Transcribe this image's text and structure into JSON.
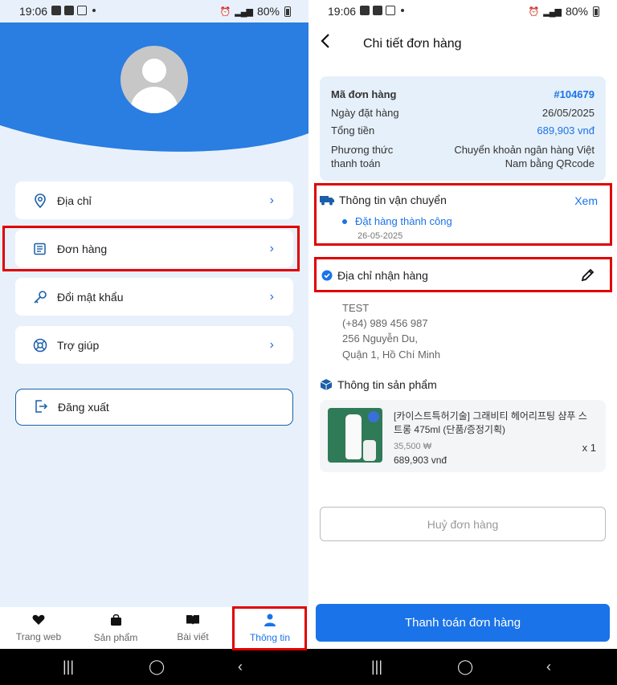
{
  "left": {
    "status": {
      "time": "19:06",
      "battery": "80%",
      "network": "Vo) LTE1"
    },
    "menu": [
      {
        "label": "Địa chỉ",
        "icon": "location-pin-icon"
      },
      {
        "label": "Đơn hàng",
        "icon": "receipt-icon"
      },
      {
        "label": "Đổi mật khẩu",
        "icon": "key-icon"
      },
      {
        "label": "Trợ giúp",
        "icon": "lifebuoy-icon"
      }
    ],
    "logout_label": "Đăng xuất",
    "nav": [
      {
        "label": "Trang web",
        "icon": "heart-icon"
      },
      {
        "label": "Sản phẩm",
        "icon": "shopping-bag-icon"
      },
      {
        "label": "Bài viết",
        "icon": "book-icon"
      },
      {
        "label": "Thông tin",
        "icon": "person-icon"
      }
    ]
  },
  "right": {
    "status": {
      "time": "19:06",
      "battery": "80%",
      "network": "Vo) LTE1"
    },
    "title": "Chi tiết đơn hàng",
    "summary": {
      "order_label": "Mã đơn hàng",
      "order_value": "#104679",
      "date_label": "Ngày đặt hàng",
      "date_value": "26/05/2025",
      "total_label": "Tổng tiền",
      "total_value": "689,903 vnđ",
      "payment_label_1": "Phương thức",
      "payment_label_2": "thanh toán",
      "payment_value_1": "Chuyển khoản ngân hàng Việt",
      "payment_value_2": "Nam bằng QRcode"
    },
    "shipping": {
      "title": "Thông tin vận chuyển",
      "view_link": "Xem",
      "status": "Đặt hàng thành công",
      "date": "26-05-2025"
    },
    "address": {
      "title": "Địa chỉ nhận hàng",
      "name": "TEST",
      "phone": "(+84) 989 456 987",
      "street": "256 Nguyễn Du,",
      "city": "Quận 1, Hồ Chí Minh"
    },
    "product_section_title": "Thông tin sản phẩm",
    "product": {
      "name": "[카이스트특허기술] 그래비티 헤어리프팅 샴푸 스트롱 475ml (단품/증정기획)",
      "price": "35,500 ₩",
      "total": "689,903 vnđ",
      "qty": "x 1"
    },
    "cancel_label": "Huỷ đơn hàng",
    "pay_label": "Thanh toán đơn hàng"
  },
  "colors": {
    "primary": "#1a73e8",
    "header_blue": "#2a7de1",
    "highlight": "#e00000"
  }
}
